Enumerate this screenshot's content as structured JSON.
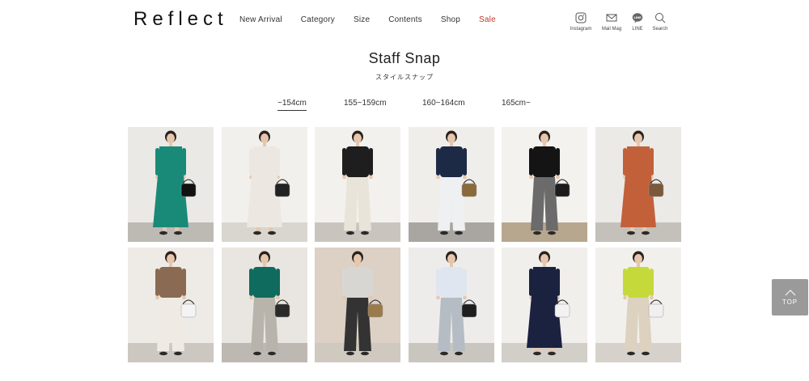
{
  "header": {
    "logo": "Reflect",
    "nav": [
      "New Arrival",
      "Category",
      "Size",
      "Contents",
      "Shop",
      "Sale"
    ],
    "utility": [
      {
        "label": "Instagram",
        "icon": "instagram-icon"
      },
      {
        "label": "Mail Mag",
        "icon": "mail-icon"
      },
      {
        "label": "LINE",
        "icon": "line-icon"
      },
      {
        "label": "Search",
        "icon": "search-icon"
      }
    ]
  },
  "page": {
    "title": "Staff Snap",
    "subtitle": "スタイルスナップ"
  },
  "tabs": [
    {
      "label": "~154cm",
      "active": true
    },
    {
      "label": "155~159cm",
      "active": false
    },
    {
      "label": "160~164cm",
      "active": false
    },
    {
      "label": "165cm~",
      "active": false
    }
  ],
  "colors": {
    "sale": "#c0392b",
    "top_button_bg": "#9a9a9a"
  },
  "snaps": [
    {
      "bg": "#ebe9e6",
      "floor": "#bdbab4",
      "top": "#1a8a78",
      "bottom": "#1a8a78",
      "bag": "#111111",
      "dress": true
    },
    {
      "bg": "#f2f0ed",
      "floor": "#d9d6d0",
      "top": "#ece8e1",
      "bottom": "#ece8e1",
      "bag": "#222222",
      "dress": true
    },
    {
      "bg": "#f3f1ee",
      "floor": "#c9c5be",
      "top": "#1e1e1e",
      "bottom": "#e9e4d9",
      "bag": null,
      "dress": false
    },
    {
      "bg": "#f0eeeb",
      "floor": "#a9a6a1",
      "top": "#1d2a45",
      "bottom": "#eef0f2",
      "bag": "#8a6a3a",
      "dress": false
    },
    {
      "bg": "#f4f2ef",
      "floor": "#b7a78e",
      "top": "#141414",
      "bottom": "#6b6b6b",
      "bag": "#1c1c1c",
      "dress": false
    },
    {
      "bg": "#eceae7",
      "floor": "#c4c0ba",
      "top": "#c2603a",
      "bottom": "#c2603a",
      "bag": "#7a5a3a",
      "dress": true
    },
    {
      "bg": "#eeebe7",
      "floor": "#ccc7c0",
      "top": "#8a6a52",
      "bottom": "#efebe4",
      "bag": "#f4f4f4",
      "dress": false
    },
    {
      "bg": "#e9e6e1",
      "floor": "#bdb9b2",
      "top": "#0f6b5e",
      "bottom": "#b9b4ab",
      "bag": "#2a2a2a",
      "dress": false
    },
    {
      "bg": "#ddd0c4",
      "floor": "#cfc9c0",
      "top": "#d8d6d2",
      "bottom": "#333333",
      "bag": "#9a7a4a",
      "dress": false
    },
    {
      "bg": "#eeecea",
      "floor": "#c9c6c0",
      "top": "#dfe6ef",
      "bottom": "#b6bcc4",
      "bag": "#1e1e1e",
      "dress": false
    },
    {
      "bg": "#f1efec",
      "floor": "#d2cec8",
      "top": "#1b2240",
      "bottom": "#1b2240",
      "bag": "#f2f2f2",
      "dress": true
    },
    {
      "bg": "#f2f0ec",
      "floor": "#d6d2cb",
      "top": "#c5d93a",
      "bottom": "#ddd2bf",
      "bag": "#f0f0f0",
      "dress": false
    }
  ],
  "top_button": {
    "label": "TOP"
  }
}
